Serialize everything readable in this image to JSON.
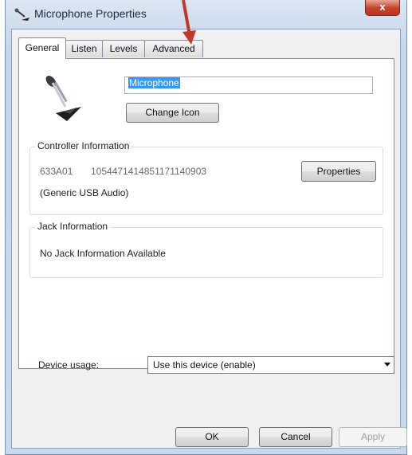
{
  "window": {
    "title": "Microphone Properties",
    "close_glyph": "x"
  },
  "tabs": [
    {
      "label": "General",
      "active": true
    },
    {
      "label": "Listen",
      "active": false
    },
    {
      "label": "Levels",
      "active": false
    },
    {
      "label": "Advanced",
      "active": false
    }
  ],
  "general": {
    "device_name": "Microphone",
    "change_icon_label": "Change Icon",
    "controller": {
      "title": "Controller Information",
      "id": "633A01",
      "serial": "1054471414851171140903",
      "name": "(Generic USB Audio)",
      "properties_label": "Properties"
    },
    "jack": {
      "title": "Jack Information",
      "text": "No Jack Information Available"
    },
    "device_usage": {
      "label": "Device usage:",
      "selected": "Use this device (enable)"
    }
  },
  "footer": {
    "ok_label": "OK",
    "cancel_label": "Cancel",
    "apply_label": "Apply",
    "apply_enabled": false
  },
  "annotation": {
    "arrow_color": "#c0392b"
  },
  "colors": {
    "selection": "#3399ff",
    "close_button": "#c5422b"
  }
}
